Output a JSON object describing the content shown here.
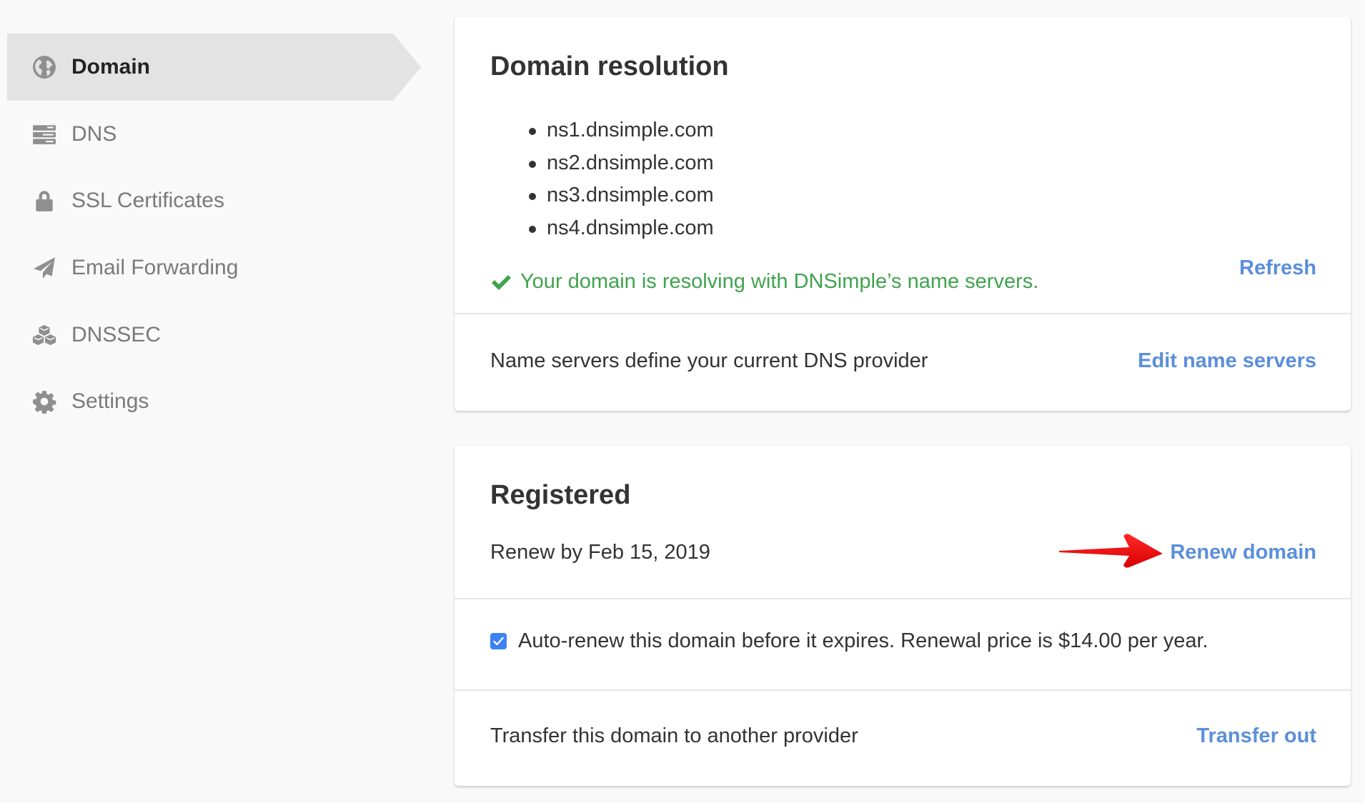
{
  "sidebar": {
    "items": [
      {
        "label": "Domain",
        "icon": "globe-icon",
        "active": true
      },
      {
        "label": "DNS",
        "icon": "server-icon",
        "active": false
      },
      {
        "label": "SSL Certificates",
        "icon": "lock-icon",
        "active": false
      },
      {
        "label": "Email Forwarding",
        "icon": "paper-plane-icon",
        "active": false
      },
      {
        "label": "DNSSEC",
        "icon": "cubes-icon",
        "active": false
      },
      {
        "label": "Settings",
        "icon": "gear-icon",
        "active": false
      }
    ]
  },
  "resolution": {
    "title": "Domain resolution",
    "name_servers": [
      "ns1.dnsimple.com",
      "ns2.dnsimple.com",
      "ns3.dnsimple.com",
      "ns4.dnsimple.com"
    ],
    "status_text": "Your domain is resolving with DNSimple’s name servers.",
    "status_color": "#3fa34d",
    "refresh_label": "Refresh",
    "description": "Name servers define your current DNS provider",
    "edit_label": "Edit name servers"
  },
  "registered": {
    "title": "Registered",
    "renew_by": "Renew by Feb 15, 2019",
    "renew_label": "Renew domain",
    "auto_renew_checked": true,
    "auto_renew_text": "Auto-renew this domain before it expires. Renewal price is $14.00 per year.",
    "transfer_text": "Transfer this domain to another provider",
    "transfer_label": "Transfer out"
  },
  "colors": {
    "link": "#5b8fd9",
    "success": "#3fa34d",
    "checkbox": "#3b82f6",
    "annotation_arrow": "#e00000"
  }
}
